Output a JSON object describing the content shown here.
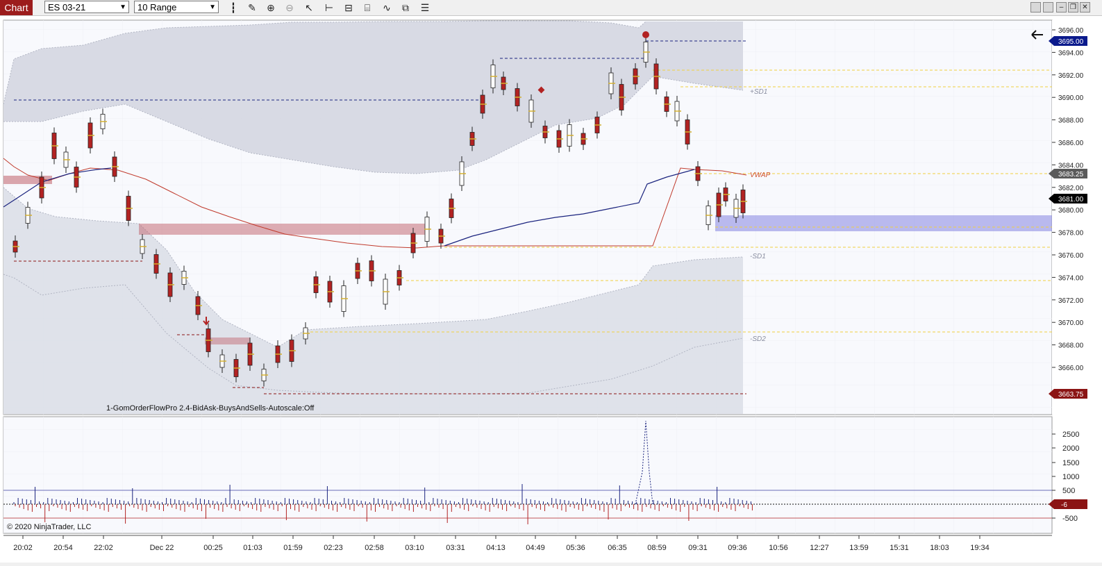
{
  "toolbar": {
    "chart_tab": "Chart",
    "instrument": "ES 03-21",
    "bar_type": "10 Range",
    "icons": [
      "bar-type-icon",
      "pencil-icon",
      "zoom-in-icon",
      "zoom-out-icon",
      "pointer-icon",
      "drawing-tools-icon",
      "templates-icon",
      "strategies-icon",
      "indicators-icon",
      "properties-icon",
      "menu-icon"
    ]
  },
  "price_axis": {
    "ticks": [
      "3696.00",
      "3694.00",
      "3692.00",
      "3690.00",
      "3688.00",
      "3686.00",
      "3684.00",
      "3682.00",
      "3680.00",
      "3678.00",
      "3676.00",
      "3674.00",
      "3672.00",
      "3670.00",
      "3668.00",
      "3666.00"
    ],
    "markers": [
      {
        "label": "3695.00",
        "color": "#0b1a8c"
      },
      {
        "label": "3683.25",
        "color": "#5a5a5a"
      },
      {
        "label": "3681.00",
        "color": "#000000"
      },
      {
        "label": "3663.75",
        "color": "#8b1414"
      }
    ]
  },
  "indicator_axis": {
    "ticks": [
      "2500",
      "2000",
      "1500",
      "1000",
      "500",
      "-500"
    ],
    "marker": {
      "label": "-6",
      "color": "#8b1414"
    }
  },
  "time_axis": [
    "20:02",
    "20:54",
    "22:02",
    "Dec 22",
    "00:25",
    "01:03",
    "01:59",
    "02:23",
    "02:58",
    "03:10",
    "03:31",
    "04:13",
    "04:49",
    "05:36",
    "06:35",
    "08:59",
    "09:31",
    "09:36",
    "10:56",
    "12:27",
    "13:59",
    "15:31",
    "18:03",
    "19:34"
  ],
  "band_labels": {
    "plus_sd1": "+SD1",
    "vwap": "VWAP",
    "minus_sd1": "-SD1",
    "minus_sd2": "-SD2"
  },
  "indicator_label": "1-GomOrderFlowPro 2.4-BidAsk-BuysAndSells-Autoscale:Off",
  "copyright": "© 2020 NinjaTrader, LLC",
  "colors": {
    "bear": "#b22222",
    "bull": "#ffffff",
    "vwap": "#c0392b",
    "ema": "#1a237e",
    "zone": "#6a6ad8",
    "level": "#f0d040"
  }
}
